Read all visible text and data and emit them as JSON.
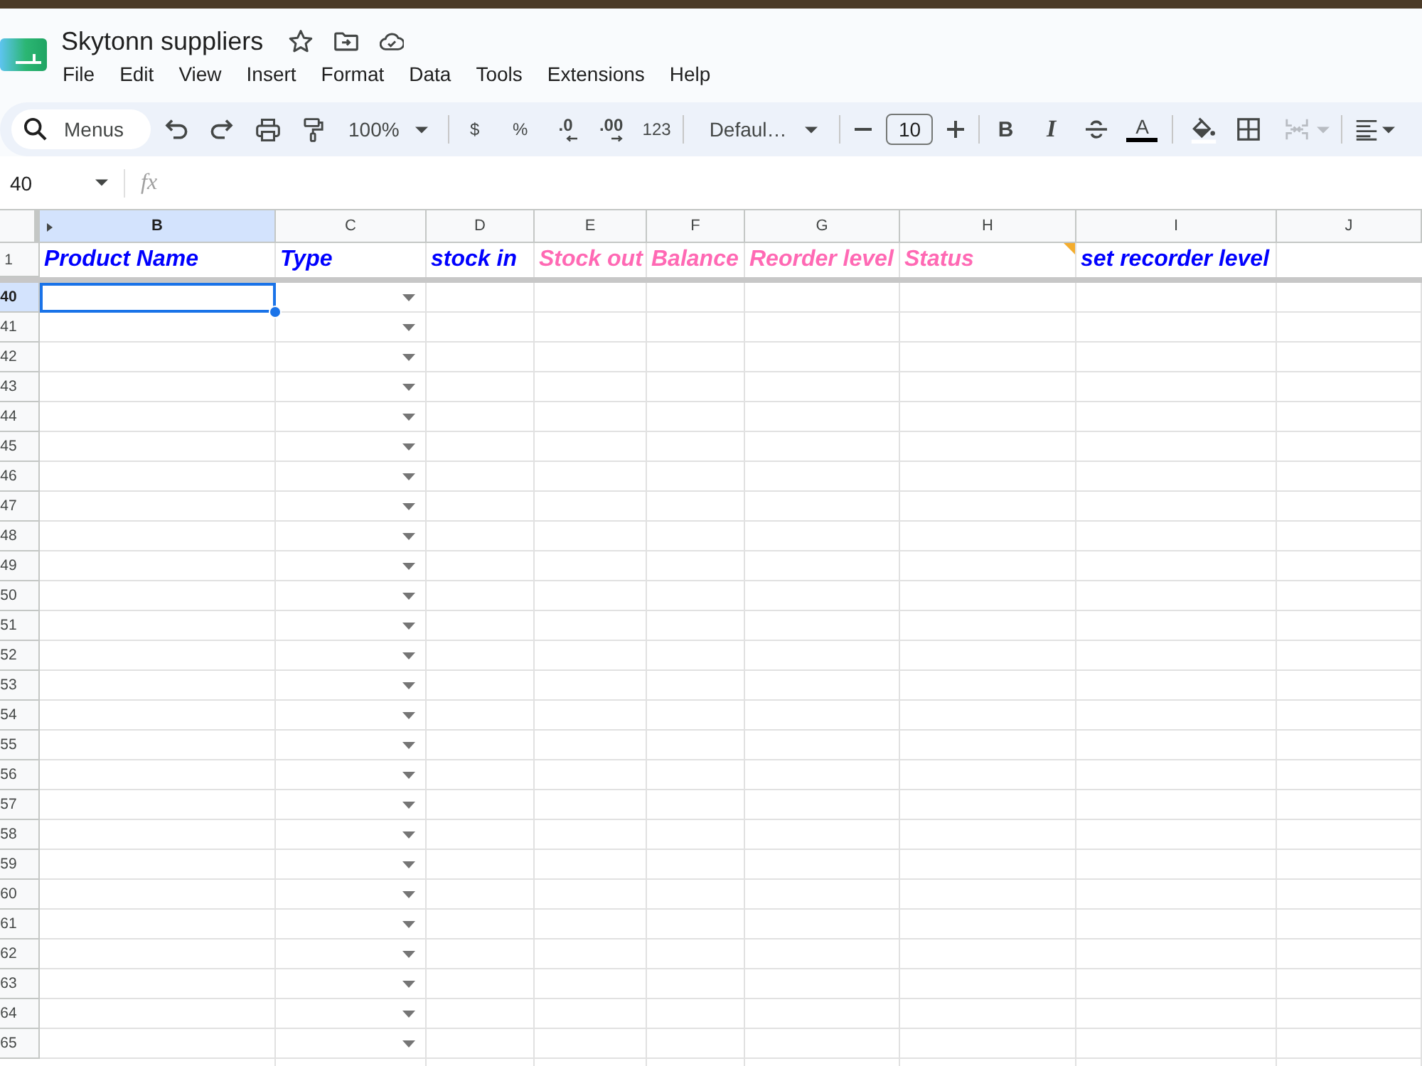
{
  "app": {
    "title": "Skytonn suppliers",
    "menu": [
      "File",
      "Edit",
      "View",
      "Insert",
      "Format",
      "Data",
      "Tools",
      "Extensions",
      "Help"
    ]
  },
  "toolbar": {
    "search": {
      "label": "Menus"
    },
    "zoom": "100%",
    "number_formats": [
      {
        "kind": "currency",
        "label": "$"
      },
      {
        "kind": "percent",
        "label": "%"
      },
      {
        "kind": "decrease_decimals",
        "label": ".0"
      },
      {
        "kind": "increase_decimals",
        "label": ".00"
      },
      {
        "kind": "more_formats",
        "label": "123"
      }
    ],
    "font": "Defaul…",
    "font_size": "10",
    "text_styles": [
      {
        "kind": "bold",
        "label": "B"
      },
      {
        "kind": "italic",
        "label": "I"
      },
      {
        "kind": "strikethrough"
      },
      {
        "kind": "text_color",
        "label": "A"
      }
    ],
    "merge": {
      "disabled": true
    }
  },
  "formula_bar": {
    "cell_ref": "40",
    "fx": "fx"
  },
  "sheet": {
    "columns": [
      {
        "label": "B",
        "selected": true,
        "hidden_before": true,
        "dropdown": false
      },
      {
        "label": "C",
        "selected": false,
        "hidden_before": false,
        "dropdown": true
      },
      {
        "label": "D",
        "selected": false,
        "hidden_before": false,
        "dropdown": false
      },
      {
        "label": "E",
        "selected": false,
        "hidden_before": false,
        "dropdown": false
      },
      {
        "label": "F",
        "selected": false,
        "hidden_before": false,
        "dropdown": false
      },
      {
        "label": "G",
        "selected": false,
        "hidden_before": false,
        "dropdown": false
      },
      {
        "label": "H",
        "selected": false,
        "hidden_before": false,
        "dropdown": false
      },
      {
        "label": "I",
        "selected": false,
        "hidden_before": false,
        "dropdown": false
      },
      {
        "label": "J",
        "selected": false,
        "hidden_before": false,
        "dropdown": false
      }
    ],
    "header_row": {
      "number": "1",
      "cells": [
        {
          "text": "Product Name",
          "color": "#0000ff",
          "note": false
        },
        {
          "text": "Type",
          "color": "#0000ff",
          "note": false
        },
        {
          "text": "stock in",
          "color": "#0000ff",
          "note": false
        },
        {
          "text": "Stock out",
          "color": "#ff69b4",
          "note": false
        },
        {
          "text": "Balance",
          "color": "#ff69b4",
          "note": false
        },
        {
          "text": "Reorder level",
          "color": "#ff69b4",
          "note": false
        },
        {
          "text": "Status",
          "color": "#ff69b4",
          "note": true
        },
        {
          "text": "set recorder level",
          "color": "#0000ff",
          "note": false
        }
      ]
    },
    "rows": [
      {
        "number": "40",
        "selected": true
      },
      {
        "number": "41",
        "selected": false
      },
      {
        "number": "42",
        "selected": false
      },
      {
        "number": "43",
        "selected": false
      },
      {
        "number": "44",
        "selected": false
      },
      {
        "number": "45",
        "selected": false
      },
      {
        "number": "46",
        "selected": false
      },
      {
        "number": "47",
        "selected": false
      },
      {
        "number": "48",
        "selected": false
      },
      {
        "number": "49",
        "selected": false
      },
      {
        "number": "50",
        "selected": false
      },
      {
        "number": "51",
        "selected": false
      },
      {
        "number": "52",
        "selected": false
      },
      {
        "number": "53",
        "selected": false
      },
      {
        "number": "54",
        "selected": false
      },
      {
        "number": "55",
        "selected": false
      },
      {
        "number": "56",
        "selected": false
      },
      {
        "number": "57",
        "selected": false
      },
      {
        "number": "58",
        "selected": false
      },
      {
        "number": "59",
        "selected": false
      },
      {
        "number": "60",
        "selected": false
      },
      {
        "number": "61",
        "selected": false
      },
      {
        "number": "62",
        "selected": false
      },
      {
        "number": "63",
        "selected": false
      },
      {
        "number": "64",
        "selected": false
      },
      {
        "number": "65",
        "selected": false
      }
    ]
  }
}
